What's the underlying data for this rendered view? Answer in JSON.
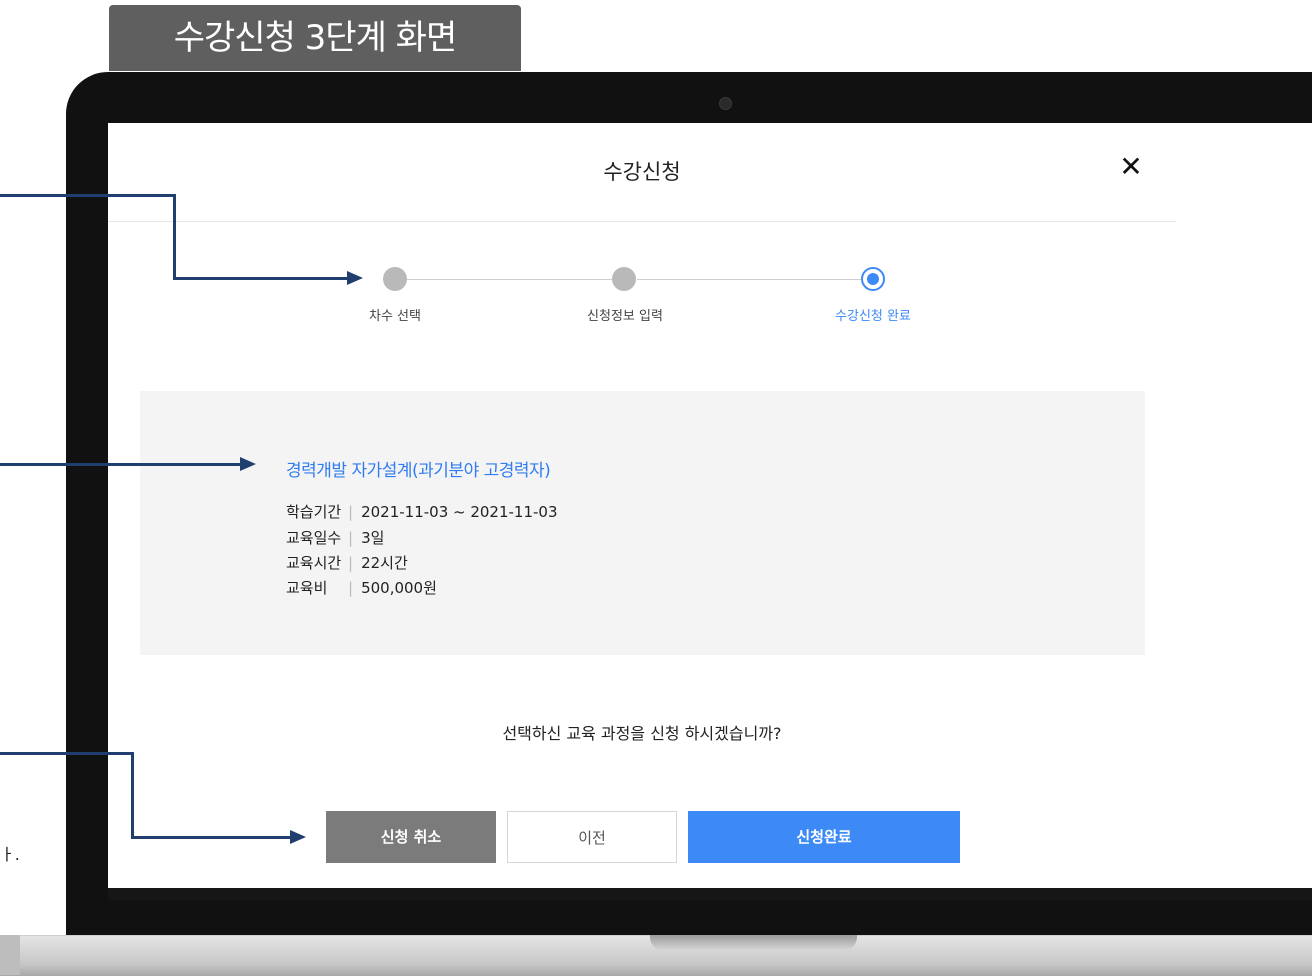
{
  "header_tag": "수강신청 3단계 화면",
  "modal": {
    "title": "수강신청",
    "close_icon": "close-icon"
  },
  "steps": [
    {
      "label": "차수 선택",
      "state": "done"
    },
    {
      "label": "신청정보 입력",
      "state": "done"
    },
    {
      "label": "수강신청 완료",
      "state": "active"
    }
  ],
  "course": {
    "title": "경력개발 자가설계(과기분야 고경력자)",
    "rows": [
      {
        "label": "학습기간",
        "value": "2021-11-03 ~ 2021-11-03"
      },
      {
        "label": "교육일수",
        "value": "3일"
      },
      {
        "label": "교육시간",
        "value": "22시간"
      },
      {
        "label": "교육비",
        "value": "500,000원"
      }
    ]
  },
  "question": "선택하신 교육 과정을 신청 하시겠습니까?",
  "buttons": {
    "cancel": "신청 취소",
    "prev": "이전",
    "complete": "신청완료"
  },
  "side_text": "ㅏ.",
  "colors": {
    "accent": "#3d8af7",
    "annotation": "#213f6e",
    "header_tag_bg": "#5f5f5f",
    "cancel_bg": "#7b7b7b",
    "info_bg": "#f4f4f4"
  }
}
